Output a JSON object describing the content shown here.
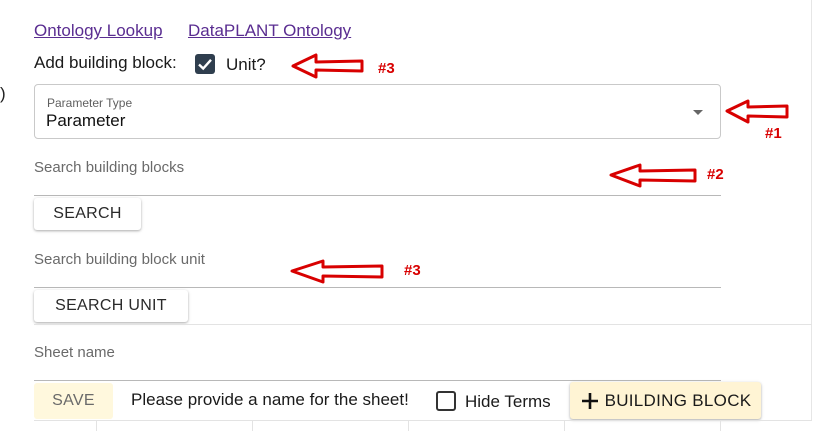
{
  "links": {
    "ontology_lookup": "Ontology Lookup",
    "dataplant_ontology": "DataPLANT Ontology"
  },
  "add_block": {
    "label": "Add building block:",
    "unit_label": "Unit?",
    "unit_checked": true
  },
  "parameter_type": {
    "label": "Parameter Type",
    "value": "Parameter"
  },
  "search": {
    "placeholder": "Search building blocks",
    "button": "SEARCH"
  },
  "search_unit": {
    "placeholder": "Search building block unit",
    "button": "SEARCH UNIT"
  },
  "sheet": {
    "placeholder": "Sheet name"
  },
  "bottom_bar": {
    "save": "SAVE",
    "message": "Please provide a name for the sheet!",
    "hide_terms": "Hide Terms",
    "hide_terms_checked": false,
    "add_block_icon": "plus-icon",
    "add_block": "BUILDING BLOCK"
  },
  "annotations": {
    "unit": "#3",
    "parameter_type": "#1",
    "search": "#2",
    "search_unit": "#3"
  },
  "colors": {
    "link": "#5a2d91",
    "checkbox_checked": "#2f3e4e",
    "annotation": "#d80000",
    "save_bg": "#fff8dd",
    "building_block_bg": "#fff4d4"
  }
}
